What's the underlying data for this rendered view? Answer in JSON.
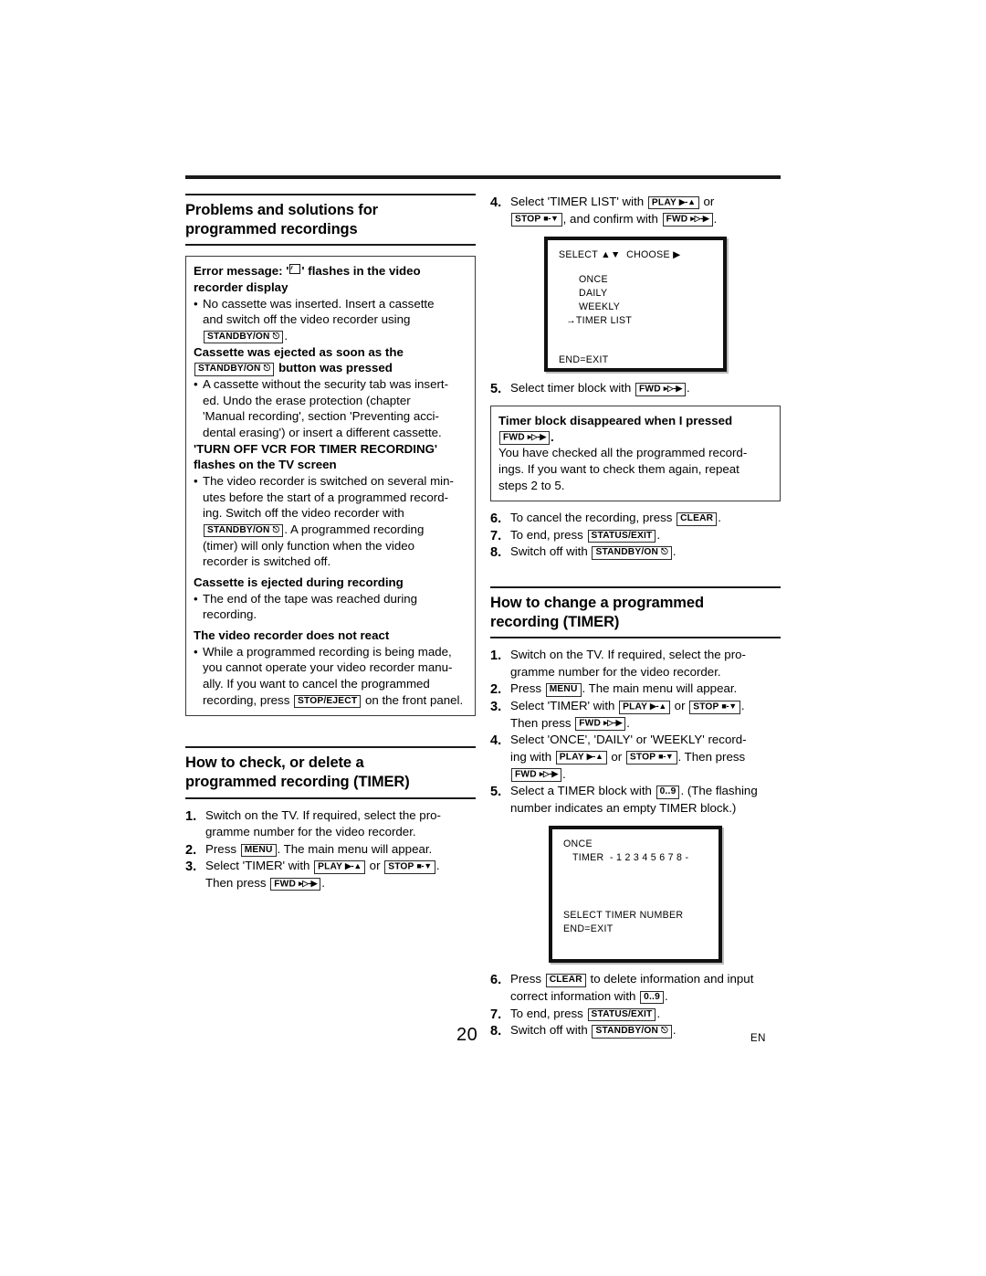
{
  "page": {
    "number": "20",
    "language_code": "EN"
  },
  "left_column": {
    "heading": {
      "line1": "Problems and solutions for",
      "line2": "programmed recordings"
    },
    "note_box": {
      "entries": [
        {
          "title_parts": [
            {
              "type": "text",
              "text": "Error message: '"
            },
            {
              "type": "glyph",
              "name": "cassette-symbol"
            },
            {
              "type": "text",
              "text": "' flashes in the video"
            }
          ],
          "title_line2": "recorder display",
          "bullet_lines": [
            "No cassette was inserted. Insert a cassette",
            "and switch off the video recorder using"
          ],
          "bullet_key": {
            "label": "STANDBY/ON",
            "glyph": "power"
          },
          "bullet_key_suffix": "."
        },
        {
          "title_line1": "Cassette was ejected as soon as the",
          "title_key": {
            "label": "STANDBY/ON",
            "glyph": "power"
          },
          "title_line2_suffix": "button was pressed",
          "bullet_lines": [
            "A cassette without the security tab was insert-",
            "ed. Undo the erase protection (chapter",
            "'Manual recording', section 'Preventing acci-",
            "dental erasing') or insert a different cassette."
          ]
        },
        {
          "title_line1": "'TURN OFF VCR FOR TIMER RECORDING'",
          "title_line2": "flashes on the TV screen",
          "bullet_lines_a": [
            "The video recorder is switched on several min-",
            "utes before the start of a programmed record-",
            "ing. Switch off the video recorder with"
          ],
          "mid_key": {
            "label": "STANDBY/ON",
            "glyph": "power"
          },
          "mid_key_suffix": ". A programmed recording",
          "bullet_lines_b": [
            "(timer) will only function when the video",
            "recorder is switched off."
          ]
        },
        {
          "title_line1": "Cassette is ejected during recording",
          "bullet_lines": [
            "The end of the tape was reached during",
            "recording."
          ]
        },
        {
          "title_line1": "The video recorder does not react",
          "bullet_lines_a": [
            "While a programmed recording is being made,",
            "you cannot operate your video recorder manu-",
            "ally. If you want to cancel the programmed",
            "recording, press"
          ],
          "end_key": {
            "label": "STOP/EJECT"
          },
          "end_suffix": "on the front panel."
        }
      ]
    },
    "section2": {
      "heading": {
        "line1": "How to check, or delete a",
        "line2": "programmed recording (TIMER)"
      },
      "steps": [
        {
          "num": "1.",
          "lines": [
            "Switch on the TV. If required, select the pro-",
            "gramme number for the video recorder."
          ]
        },
        {
          "num": "2.",
          "pre": "Press",
          "key": {
            "label": "MENU"
          },
          "post": ". The main menu will appear."
        },
        {
          "num": "3.",
          "pre": "Select 'TIMER' with",
          "key1": {
            "label": "PLAY",
            "glyph": "play-up"
          },
          "mid": "or",
          "key2": {
            "label": "STOP",
            "glyph": "stop-down"
          },
          "post": ".",
          "line2_pre": "Then press",
          "line2_key": {
            "label": "FWD",
            "glyph": "fwd-right"
          },
          "line2_post": "."
        }
      ]
    }
  },
  "right_column": {
    "step4": {
      "num": "4.",
      "pre": "Select 'TIMER LIST' with",
      "key1": {
        "label": "PLAY",
        "glyph": "play-up"
      },
      "mid": "or",
      "key2": {
        "label": "STOP",
        "glyph": "stop-down"
      },
      "post": ", and confirm with",
      "key3": {
        "label": "FWD",
        "glyph": "fwd-right"
      },
      "end": "."
    },
    "osd_screen_1": {
      "header": "SELECT ▲▼  CHOOSE ▶",
      "items": [
        "ONCE",
        "DAILY",
        "WEEKLY"
      ],
      "selected_item": "→TIMER LIST",
      "footer": "END=EXIT"
    },
    "step5": {
      "num": "5.",
      "pre": "Select timer block with",
      "key": {
        "label": "FWD",
        "glyph": "fwd-right"
      },
      "post": "."
    },
    "note_box": {
      "title": "Timer block disappeared when I pressed",
      "title_key": {
        "label": "FWD",
        "glyph": "fwd-right"
      },
      "title_key_suffix": ".",
      "body_lines": [
        "You have checked all the programmed record-",
        "ings. If you want to check them again, repeat",
        "steps 2 to 5."
      ]
    },
    "steps_678": [
      {
        "num": "6.",
        "pre": "To cancel the recording, press",
        "key": {
          "label": "CLEAR"
        },
        "post": "."
      },
      {
        "num": "7.",
        "pre": "To end, press",
        "key": {
          "label": "STATUS/EXIT"
        },
        "post": "."
      },
      {
        "num": "8.",
        "pre": "Switch off with",
        "key": {
          "label": "STANDBY/ON",
          "glyph": "power"
        },
        "post": "."
      }
    ],
    "section2": {
      "heading": {
        "line1": "How to change a programmed",
        "line2": "recording (TIMER)"
      },
      "steps": [
        {
          "num": "1.",
          "lines": [
            "Switch on the TV. If required, select the pro-",
            "gramme number for the video recorder."
          ]
        },
        {
          "num": "2.",
          "pre": "Press",
          "key": {
            "label": "MENU"
          },
          "post": ". The main menu will appear."
        },
        {
          "num": "3.",
          "pre": "Select 'TIMER' with",
          "key1": {
            "label": "PLAY",
            "glyph": "play-up"
          },
          "mid": "or",
          "key2": {
            "label": "STOP",
            "glyph": "stop-down"
          },
          "post": ".",
          "line2_pre": "Then press",
          "line2_key": {
            "label": "FWD",
            "glyph": "fwd-right"
          },
          "line2_post": "."
        },
        {
          "num": "4.",
          "pre": "Select 'ONCE', 'DAILY' or 'WEEKLY' record-",
          "line2_pre": "ing with",
          "key1": {
            "label": "PLAY",
            "glyph": "play-up"
          },
          "mid": "or",
          "key2": {
            "label": "STOP",
            "glyph": "stop-down"
          },
          "post": ". Then press",
          "line3_key": {
            "label": "FWD",
            "glyph": "fwd-right"
          },
          "line3_post": "."
        },
        {
          "num": "5.",
          "pre": "Select a TIMER block with",
          "key": {
            "label": "0..9"
          },
          "post": ". (The flashing",
          "line2": "number indicates an empty TIMER block.)"
        }
      ]
    },
    "osd_screen_2": {
      "line1": "ONCE",
      "line2": "TIMER  - 1 2 3 4 5 6 7 8 -",
      "footer1": "SELECT TIMER NUMBER",
      "footer2": "END=EXIT"
    },
    "steps_end": [
      {
        "num": "6.",
        "pre": "Press",
        "key": {
          "label": "CLEAR"
        },
        "post": "to delete information and input",
        "line2_pre": "correct information with",
        "line2_key": {
          "label": "0..9"
        },
        "line2_post": "."
      },
      {
        "num": "7.",
        "pre": "To end, press",
        "key": {
          "label": "STATUS/EXIT"
        },
        "post": "."
      },
      {
        "num": "8.",
        "pre": "Switch off with",
        "key": {
          "label": "STANDBY/ON",
          "glyph": "power"
        },
        "post": "."
      }
    ]
  }
}
